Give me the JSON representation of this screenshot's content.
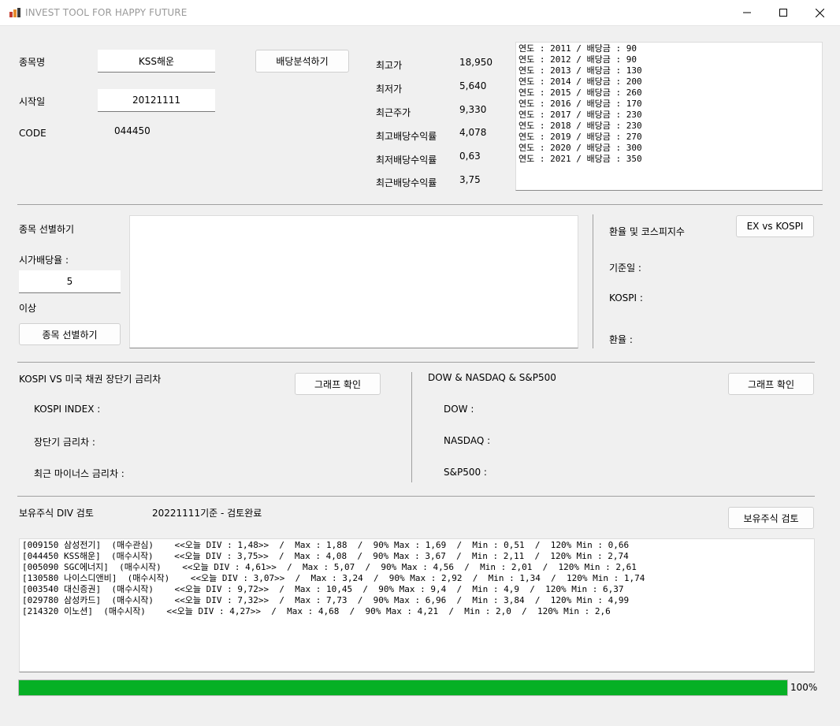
{
  "window": {
    "title": "INVEST TOOL FOR HAPPY FUTURE"
  },
  "stock_info": {
    "name_label": "종목명",
    "name_value": "KSS해운",
    "start_label": "시작일",
    "start_value": "20121111",
    "code_label": "CODE",
    "code_value": "044450",
    "analyze_button": "배당분석하기"
  },
  "stats": [
    {
      "label": "최고가",
      "value": "18,950"
    },
    {
      "label": "최저가",
      "value": "5,640"
    },
    {
      "label": "최근주가",
      "value": "9,330"
    },
    {
      "label": "최고배당수익률",
      "value": "4,078"
    },
    {
      "label": "최저배당수익률",
      "value": "0,63"
    },
    {
      "label": "최근배당수익률",
      "value": "3,75"
    }
  ],
  "dividend_history": [
    "연도 : 2011 / 배당금 : 90",
    "연도 : 2012 / 배당금 : 90",
    "연도 : 2013 / 배당금 : 130",
    "연도 : 2014 / 배당금 : 200",
    "연도 : 2015 / 배당금 : 260",
    "연도 : 2016 / 배당금 : 170",
    "연도 : 2017 / 배당금 : 230",
    "연도 : 2018 / 배당금 : 230",
    "연도 : 2019 / 배당금 : 270",
    "연도 : 2020 / 배당금 : 300",
    "연도 : 2021 / 배당금 : 350"
  ],
  "screening": {
    "title": "종목 선별하기",
    "yield_label": "시가배당율 :",
    "yield_value": "5",
    "above_label": "이상",
    "button": "종목 선별하기"
  },
  "exchange": {
    "title": "환율 및 코스피지수",
    "button": "EX vs KOSPI",
    "date_label": "기준일 :",
    "kospi_label": "KOSPI :",
    "rate_label": "환율 :"
  },
  "kospi_bond": {
    "title": "KOSPI VS 미국 채권 장단기 금리차",
    "button": "그래프 확인",
    "index_label": "KOSPI INDEX :",
    "spread_label": "장단기 금리차 :",
    "neg_label": "최근 마이너스 금리차 :"
  },
  "us_index": {
    "title": "DOW & NASDAQ & S&P500",
    "button": "그래프 확인",
    "dow_label": "DOW :",
    "nasdaq_label": "NASDAQ :",
    "sp_label": "S&P500 :"
  },
  "holdings": {
    "title": "보유주식 DIV 검토",
    "status": "20221111기준 - 검토완료",
    "button": "보유주식 검토",
    "lines": [
      "[009150 삼성전기]  (매수관심)    <<오늘 DIV : 1,48>>  /  Max : 1,88  /  90% Max : 1,69  /  Min : 0,51  /  120% Min : 0,66",
      "[044450 KSS해운]  (매수시작)    <<오늘 DIV : 3,75>>  /  Max : 4,08  /  90% Max : 3,67  /  Min : 2,11  /  120% Min : 2,74",
      "[005090 SGC에너지]  (매수시작)    <<오늘 DIV : 4,61>>  /  Max : 5,07  /  90% Max : 4,56  /  Min : 2,01  /  120% Min : 2,61",
      "[130580 나이스디앤비]  (매수시작)    <<오늘 DIV : 3,07>>  /  Max : 3,24  /  90% Max : 2,92  /  Min : 1,34  /  120% Min : 1,74",
      "[003540 대신증권]  (매수시작)    <<오늘 DIV : 9,72>>  /  Max : 10,45  /  90% Max : 9,4  /  Min : 4,9  /  120% Min : 6,37",
      "[029780 삼성카드]  (매수시작)    <<오늘 DIV : 7,32>>  /  Max : 7,73  /  90% Max : 6,96  /  Min : 3,84  /  120% Min : 4,99",
      "[214320 이노션]  (매수시작)    <<오늘 DIV : 4,27>>  /  Max : 4,68  /  90% Max : 4,21  /  Min : 2,0  /  120% Min : 2,6"
    ]
  },
  "progress": {
    "value": 1.0,
    "label": "100%",
    "color": "#06b025"
  },
  "icons": {
    "minimize": "minimize-icon",
    "maximize": "maximize-icon",
    "close": "close-icon",
    "app": "app-icon"
  }
}
